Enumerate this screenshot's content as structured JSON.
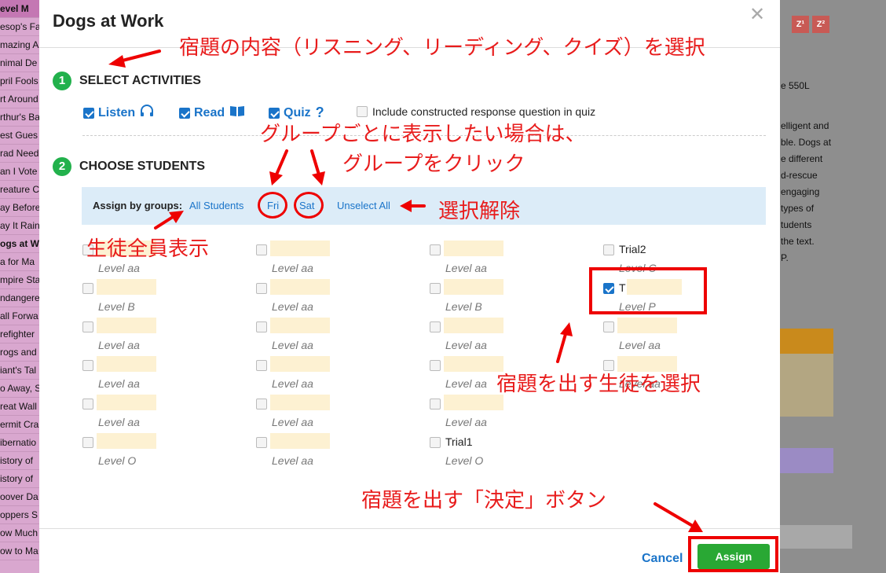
{
  "background_left": {
    "items": [
      "evel M",
      "esop's Fa",
      "mazing A",
      "nimal De",
      "pril Fools",
      "rt Around",
      "rthur's Ba",
      "est Gues",
      "rad Need",
      "an I Vote",
      "reature C",
      "ay Before",
      "ay It Rain",
      "ogs at W",
      "a for Ma",
      "mpire Sta",
      "ndangere",
      "all Forwa",
      "refighter",
      "rogs and",
      "iant's Tal",
      "o Away, S",
      "reat Wall",
      "ermit Cra",
      "ibernatio",
      "istory of",
      "istory of",
      "oover Da",
      "oppers S",
      "ow Much",
      "ow to Ma"
    ]
  },
  "background_right": {
    "zbuttons": [
      "Z¹",
      "Z²"
    ],
    "text_lines": [
      "e 550L",
      "elligent and",
      "ble. Dogs at",
      "e different",
      "d-rescue",
      "engaging",
      "types of",
      "tudents",
      "the text.",
      "P."
    ],
    "colors": {
      "orange": "#c98a1c",
      "tan": "#b3a682",
      "purple": "#9b8bc4"
    }
  },
  "modal": {
    "title": "Dogs at Work",
    "close_glyph": "✕",
    "step1": {
      "number": "1",
      "label": "SELECT ACTIVITIES"
    },
    "activities": [
      {
        "label": "Listen",
        "checked": true,
        "icon": "headphones-icon"
      },
      {
        "label": "Read",
        "checked": true,
        "icon": "book-icon"
      },
      {
        "label": "Quiz",
        "checked": true,
        "icon": "question-icon"
      }
    ],
    "constructed_label": "Include constructed response question in quiz",
    "step2": {
      "number": "2",
      "label": "CHOOSE STUDENTS"
    },
    "groups": {
      "label": "Assign by groups:",
      "links": [
        "All Students",
        "Fri",
        "Sat",
        "Unselect All"
      ]
    },
    "students": [
      {
        "name": "",
        "level": "Level aa",
        "checked": false
      },
      {
        "name": "",
        "level": "Level aa",
        "checked": false
      },
      {
        "name": "",
        "level": "Level aa",
        "checked": false
      },
      {
        "name": "Trial2",
        "level": "Level C",
        "checked": false
      },
      {
        "name": "",
        "level": "Level B",
        "checked": false
      },
      {
        "name": "",
        "level": "Level aa",
        "checked": false
      },
      {
        "name": "",
        "level": "Level B",
        "checked": false
      },
      {
        "name": "T",
        "level": "Level P",
        "checked": true
      },
      {
        "name": "",
        "level": "Level aa",
        "checked": false
      },
      {
        "name": "",
        "level": "Level aa",
        "checked": false
      },
      {
        "name": "",
        "level": "Level aa",
        "checked": false
      },
      {
        "name": "",
        "level": "Level aa",
        "checked": false
      },
      {
        "name": "",
        "level": "Level aa",
        "checked": false
      },
      {
        "name": "",
        "level": "Level aa",
        "checked": false
      },
      {
        "name": "",
        "level": "Level aa",
        "checked": false
      },
      {
        "name": "",
        "level": "Level aa",
        "checked": false
      },
      {
        "name": "",
        "level": "Level aa",
        "checked": false
      },
      {
        "name": "",
        "level": "Level aa",
        "checked": false
      },
      {
        "name": "",
        "level": "Level aa",
        "checked": false
      },
      {
        "name": "",
        "level": "Level O",
        "checked": false
      },
      {
        "name": "",
        "level": "Level aa",
        "checked": false
      },
      {
        "name": "Trial1",
        "level": "Level O",
        "checked": false
      }
    ],
    "footer": {
      "cancel": "Cancel",
      "assign": "Assign"
    }
  },
  "annotations": {
    "select_activities": "宿題の内容（リスニング、リーディング、クイズ）を選択",
    "groups_line1": "グループごとに表示したい場合は、",
    "groups_line2": "グループをクリック",
    "unselect": "選択解除",
    "all_students": "生徒全員表示",
    "choose_student": "宿題を出す生徒を選択",
    "assign_button": "宿題を出す「決定」ボタン"
  },
  "colors": {
    "accent": "#1a74c9",
    "green": "#22b14c",
    "assign_green": "#29a834",
    "annotation_red": "#e81c1c",
    "group_bar": "#dcecf8",
    "blurred_name": "#fdf1d2"
  }
}
